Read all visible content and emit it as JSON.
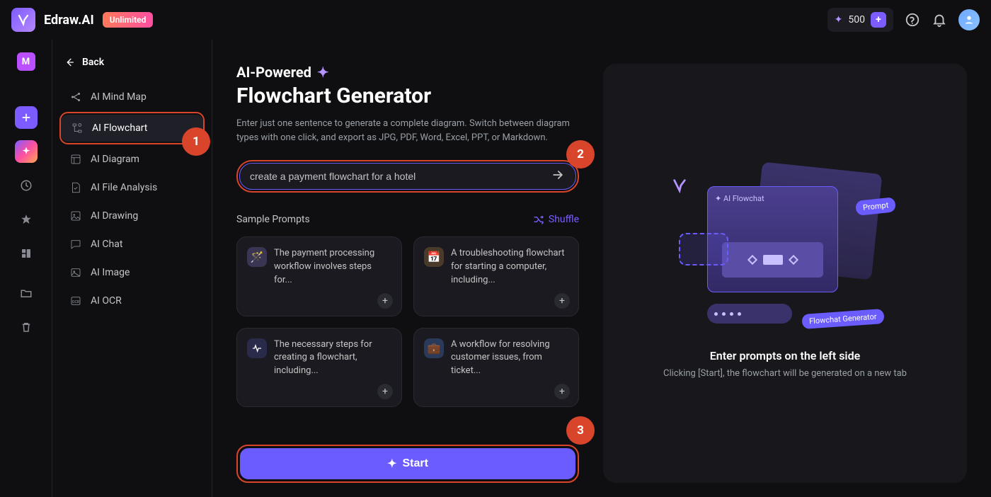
{
  "topbar": {
    "brand": "Edraw.AI",
    "unlimited": "Unlimited",
    "credits": "500"
  },
  "rail": {
    "badge": "M"
  },
  "tool": {
    "back": "Back",
    "items": [
      {
        "label": "AI Mind Map"
      },
      {
        "label": "AI Flowchart"
      },
      {
        "label": "AI Diagram"
      },
      {
        "label": "AI File Analysis"
      },
      {
        "label": "AI Drawing"
      },
      {
        "label": "AI Chat"
      },
      {
        "label": "AI Image"
      },
      {
        "label": "AI OCR"
      }
    ]
  },
  "heading": {
    "small": "AI-Powered",
    "big": "Flowchart Generator",
    "desc": "Enter just one sentence to generate a complete diagram. Switch between diagram types with one click, and export as JPG, PDF, Word, Excel, PPT, or Markdown."
  },
  "input": {
    "value": "create a payment flowchart for a hotel"
  },
  "sample": {
    "header": "Sample Prompts",
    "shuffle": "Shuffle",
    "cards": [
      {
        "text": "The payment processing workflow involves steps for..."
      },
      {
        "text": "A troubleshooting flowchart for starting a computer, including..."
      },
      {
        "text": "The necessary steps for creating a flowchart, including..."
      },
      {
        "text": "A workflow for resolving customer issues, from ticket..."
      }
    ]
  },
  "start": {
    "label": "Start"
  },
  "preview": {
    "title": "Enter prompts on the left side",
    "sub": "Clicking [Start], the flowchart will be generated on a new tab",
    "illu": {
      "a": "AI Flowchat",
      "b": "Prompt",
      "c": "Flowchat Generator"
    }
  },
  "badges": {
    "b1": "1",
    "b2": "2",
    "b3": "3"
  }
}
